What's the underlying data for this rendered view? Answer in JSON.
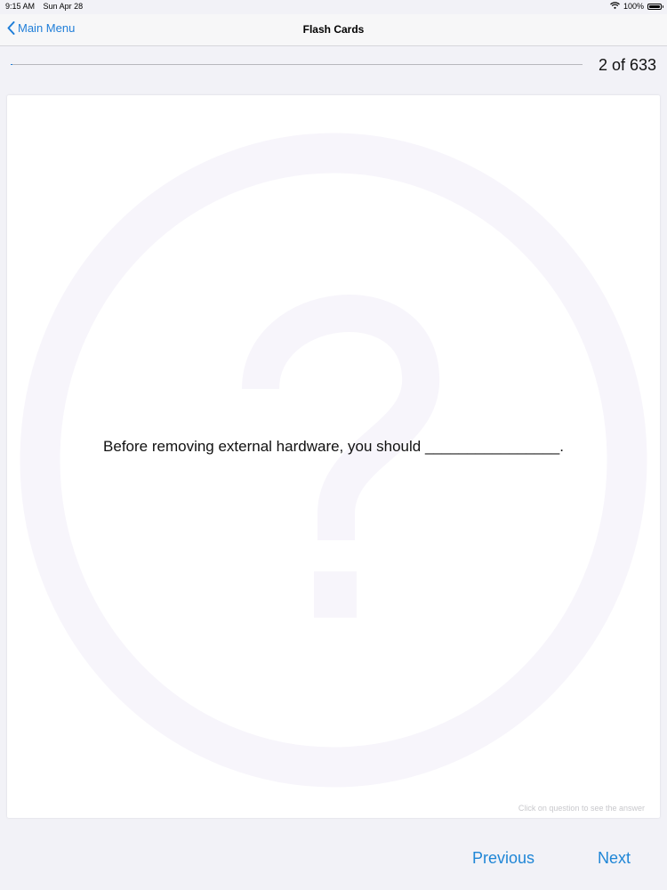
{
  "status_bar": {
    "time": "9:15 AM",
    "date": "Sun Apr 28",
    "battery": "100%",
    "wifi_icon": "wifi-icon",
    "battery_icon": "battery-icon"
  },
  "nav_bar": {
    "back_label": "Main Menu",
    "back_icon": "chevron-left-icon",
    "title": "Flash Cards"
  },
  "progress": {
    "current": 2,
    "total": 633,
    "label": "2 of 633",
    "fraction": 0.00316
  },
  "card": {
    "question": "Before removing external hardware, you should ________________.",
    "hint": "Click on question to see the answer",
    "watermark_icon": "question-mark-icon"
  },
  "footer": {
    "previous_label": "Previous",
    "next_label": "Next"
  },
  "colors": {
    "accent": "#1f7ed8",
    "watermark": "#f7f5fb"
  }
}
